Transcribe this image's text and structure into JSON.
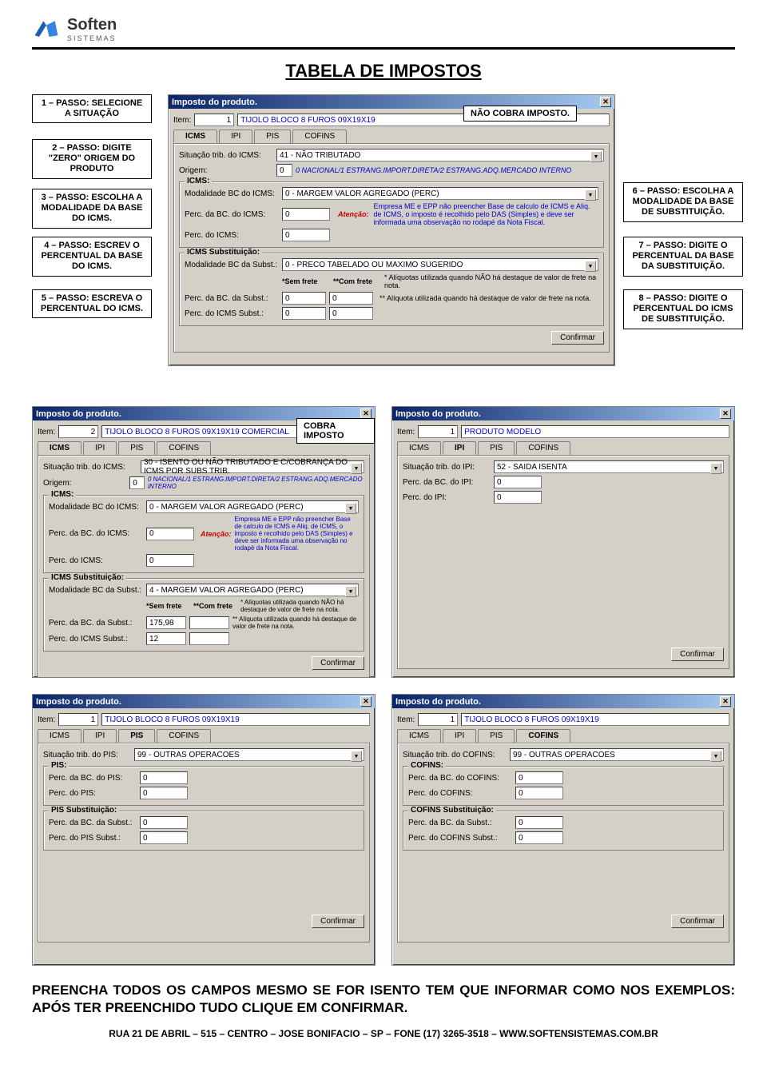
{
  "brand": {
    "name": "Soften",
    "sub": "SISTEMAS"
  },
  "title": "TABELA DE IMPOSTOS",
  "callouts": {
    "c1": "1 – PASSO: SELECIONE A SITUAÇÃO",
    "c2": "2 – PASSO: DIGITE \"ZERO\" ORIGEM DO PRODUTO",
    "c3": "3 – PASSO: ESCOLHA A MODALIDADE DA BASE DO ICMS.",
    "c4": "4 – PASSO: ESCREV O PERCENTUAL DA BASE DO ICMS.",
    "c5": "5 – PASSO: ESCREVA O PERCENTUAL DO ICMS.",
    "c6": "6 – PASSO: ESCOLHA A MODALIDADE DA BASE DE SUBSTITUIÇÃO.",
    "c7": "7 – PASSO: DIGITE O PERCENTUAL DA BASE DA SUBSTITUIÇÃO.",
    "c8": "8 – PASSO: DIGITE O PERCENTUAL DO ICMS DE SUBSTITUIÇÃO.",
    "nao": "NÃO COBRA IMPOSTO.",
    "cobra": "COBRA IMPOSTO"
  },
  "dlg": {
    "title": "Imposto do produto.",
    "itemLbl": "Item:",
    "itemNum": "1",
    "itemDesc": "TIJOLO BLOCO 8 FUROS 09X19X19",
    "itemDesc2": "TIJOLO BLOCO 8 FUROS 09X19X19 COMERCIAL",
    "itemNum2": "2",
    "itemDesc3": "PRODUTO MODELO",
    "tabs": {
      "icms": "ICMS",
      "ipi": "IPI",
      "pis": "PIS",
      "cofins": "COFINS"
    },
    "confirmar": "Confirmar"
  },
  "icms": {
    "sit": "Situação trib. do ICMS:",
    "sitVal": "41 - NÃO TRIBUTADO",
    "sitVal2": "30 - ISENTO OU NÃO TRIBUTADO E C/COBRANÇA DO ICMS POR SUBS TRIB.",
    "origem": "Origem:",
    "origemVal": "0",
    "origemDesc": "0 NACIONAL/1 ESTRANG.IMPORT.DIRETA/2 ESTRANG.ADQ.MERCADO INTERNO",
    "legend": "ICMS:",
    "modBC": "Modalidade BC do ICMS:",
    "modBCVal": "0 - MARGEM VALOR AGREGADO (PERC)",
    "percBC": "Perc. da BC. do ICMS:",
    "percBCVal": "0",
    "percICMS": "Perc. do ICMS:",
    "percICMSVal": "0",
    "atencao": "Atenção:",
    "atencaoTxt": "Empresa ME e EPP não preencher Base de calculo de ICMS e Aliq. de ICMS, o imposto é recolhido pelo DAS (Simples) e deve ser informada uma observação no rodapé da Nota Fiscal.",
    "subLegend": "ICMS Substituição:",
    "modBCSub": "Modalidade BC da Subst.:",
    "modBCSubVal": "0 - PRECO TABELADO OU MAXIMO SUGERIDO",
    "modBCSubVal2": "4 - MARGEM VALOR AGREGADO (PERC)",
    "semFrete": "*Sem frete",
    "comFrete": "**Com frete",
    "percBCSub": "Perc. da BC. da Subst.:",
    "percICMSSub": "Perc. do ICMS Subst.:",
    "percBCSubVal": "0",
    "percICMSSubVal": "0",
    "percBCSubVal2": "175,98",
    "percICMSSubVal2": "12",
    "nota1": "* Alíquotas utilizada quando NÃO há destaque de valor de frete na nota.",
    "nota2": "** Alíquota utilizada quando há destaque de valor de frete na nota."
  },
  "ipi": {
    "sit": "Situação trib. do IPI:",
    "sitVal": "52 - SAIDA ISENTA",
    "percBC": "Perc. da BC. do IPI:",
    "percBCVal": "0",
    "perc": "Perc. do IPI:",
    "percVal": "0"
  },
  "pis": {
    "sit": "Situação trib. do PIS:",
    "sitVal": "99 - OUTRAS OPERACOES",
    "legend": "PIS:",
    "percBC": "Perc. da BC. do PIS:",
    "percBCVal": "0",
    "perc": "Perc. do PIS:",
    "percVal": "0",
    "subLegend": "PIS Substituição:",
    "percBCSub": "Perc. da BC. da Subst.:",
    "percBCSubVal": "0",
    "percSub": "Perc. do PIS Subst.:",
    "percSubVal": "0"
  },
  "cofins": {
    "sit": "Situação trib. do COFINS:",
    "sitVal": "99 - OUTRAS OPERACOES",
    "legend": "COFINS:",
    "percBC": "Perc. da BC. do COFINS:",
    "percBCVal": "0",
    "perc": "Perc. do COFINS:",
    "percVal": "0",
    "subLegend": "COFINS Substituição:",
    "percBCSub": "Perc. da BC. da Subst.:",
    "percBCSubVal": "0",
    "percSub": "Perc. do COFINS Subst.:",
    "percSubVal": "0"
  },
  "bottom": "PREENCHA TODOS OS CAMPOS MESMO SE FOR ISENTO TEM QUE INFORMAR COMO NOS EXEMPLOS: APÓS TER PREENCHIDO TUDO CLIQUE EM CONFIRMAR.",
  "footer": "RUA 21 DE ABRIL – 515 – CENTRO – JOSE BONIFACIO – SP – FONE (17) 3265-3518 – WWW.SOFTENSISTEMAS.COM.BR"
}
